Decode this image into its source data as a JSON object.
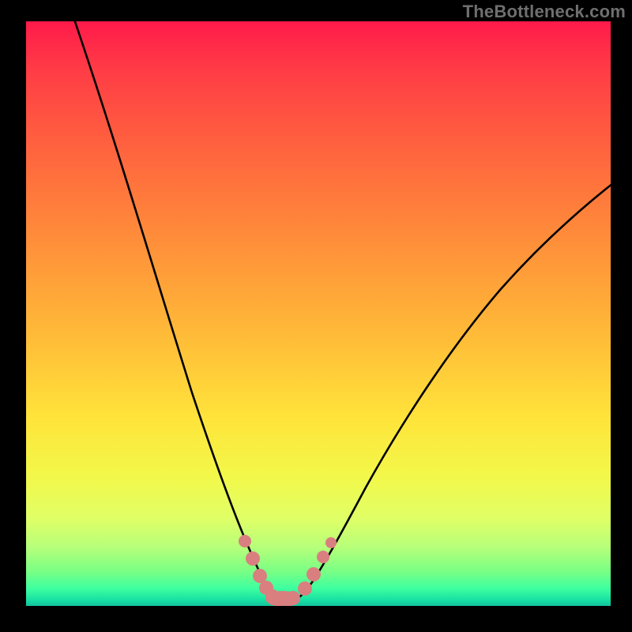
{
  "watermark": "TheBottleneck.com",
  "chart_data": {
    "type": "line",
    "title": "",
    "xlabel": "",
    "ylabel": "",
    "ylim": [
      0,
      100
    ],
    "xlim": [
      0,
      100
    ],
    "series": [
      {
        "name": "bottleneck-curve",
        "x": [
          10,
          14,
          18,
          22,
          26,
          30,
          33,
          36,
          38,
          40,
          42,
          44,
          46,
          48,
          52,
          56,
          60,
          66,
          72,
          80,
          90,
          100
        ],
        "y": [
          100,
          88,
          76,
          63,
          48,
          32,
          20,
          11,
          6,
          3,
          1,
          0.5,
          1,
          3,
          8,
          15,
          22,
          31,
          39,
          48,
          56,
          62
        ]
      }
    ],
    "markers": {
      "name": "highlight-points",
      "x": [
        36,
        38,
        40,
        42,
        44,
        46,
        48,
        50,
        52
      ],
      "y": [
        10,
        5,
        2.5,
        1.5,
        1,
        1.5,
        4,
        8,
        12
      ]
    },
    "gradient_stops": [
      {
        "pos": 0,
        "color": "#ff1a4a"
      },
      {
        "pos": 36,
        "color": "#ff8a3a"
      },
      {
        "pos": 68,
        "color": "#ffe43a"
      },
      {
        "pos": 100,
        "color": "#14c29e"
      }
    ]
  }
}
